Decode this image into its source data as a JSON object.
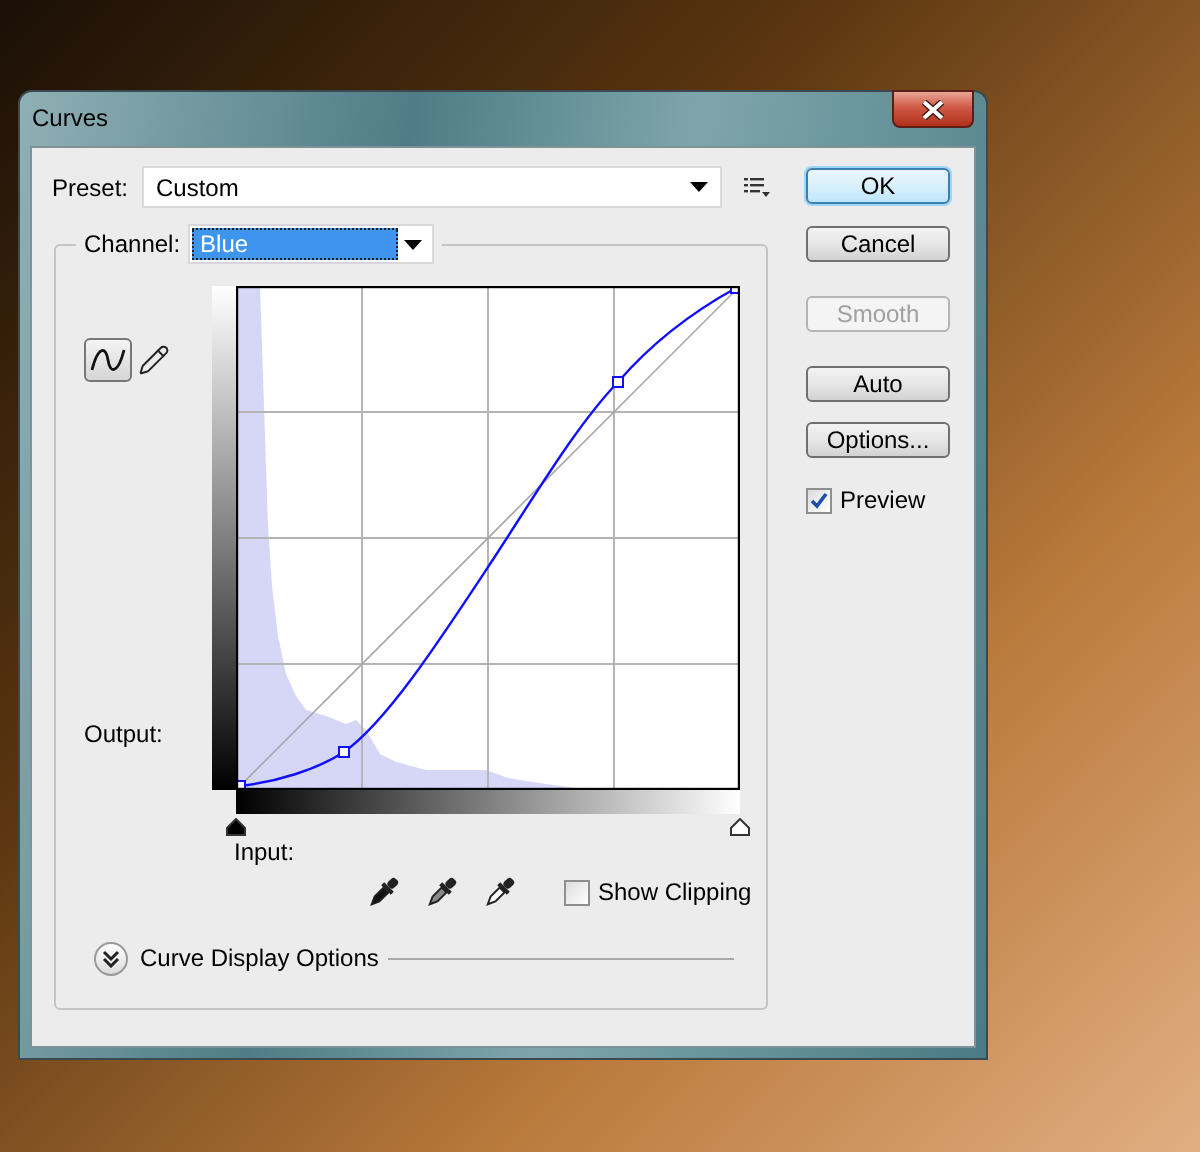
{
  "window": {
    "title": "Curves"
  },
  "preset": {
    "label": "Preset:",
    "value": "Custom"
  },
  "channel": {
    "label": "Channel:",
    "value": "Blue",
    "focused": true
  },
  "curve_tools": [
    {
      "kind": "curve",
      "selected": true
    },
    {
      "kind": "pencil",
      "selected": false
    }
  ],
  "graph": {
    "output_label": "Output:",
    "input_label": "Input:"
  },
  "show_clipping": {
    "label": "Show Clipping",
    "checked": false
  },
  "display_options": {
    "label": "Curve Display Options",
    "expanded": false
  },
  "buttons": [
    {
      "label": "OK",
      "default": true,
      "disabled": false
    },
    {
      "label": "Cancel",
      "default": false,
      "disabled": false
    },
    {
      "label": "Smooth",
      "default": false,
      "disabled": true
    },
    {
      "label": "Auto",
      "default": false,
      "disabled": false
    },
    {
      "label": "Options...",
      "default": false,
      "disabled": false
    }
  ],
  "preview": {
    "label": "Preview",
    "checked": true
  }
}
